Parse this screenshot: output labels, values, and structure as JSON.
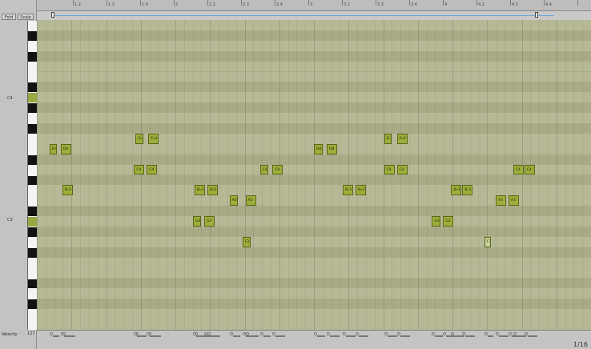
{
  "toolbar": {
    "fold_label": "Fold",
    "scale_label": "Scale"
  },
  "ruler": {
    "labels": [
      "1.2",
      "1.3",
      "1.4",
      "2",
      "2.2",
      "2.3",
      "2.4",
      "3",
      "3.2",
      "3.3",
      "3.4",
      "4",
      "4.2",
      "4.3",
      "4.4"
    ]
  },
  "keyboard": {
    "octave_labels": [
      "C4",
      "C3"
    ]
  },
  "roll": {
    "notes": [
      {
        "label": "E♭4",
        "row": 11,
        "start": 3.1,
        "dur": 0.18
      },
      {
        "label": "E♭4",
        "row": 11,
        "start": 3.5,
        "dur": 0.25
      },
      {
        "label": "D4",
        "row": 12,
        "start": 0.4,
        "dur": 0.18
      },
      {
        "label": "D4",
        "row": 12,
        "start": 0.75,
        "dur": 0.25
      },
      {
        "label": "C4",
        "row": 14,
        "start": 3.05,
        "dur": 0.25
      },
      {
        "label": "C4",
        "row": 14,
        "start": 3.45,
        "dur": 0.25
      },
      {
        "label": "C4",
        "row": 14,
        "start": 7.0,
        "dur": 0.2
      },
      {
        "label": "C4",
        "row": 14,
        "start": 7.4,
        "dur": 0.25
      },
      {
        "label": "B♭3",
        "row": 16,
        "start": 0.8,
        "dur": 0.25
      },
      {
        "label": "B♭3",
        "row": 16,
        "start": 4.95,
        "dur": 0.25
      },
      {
        "label": "B♭3",
        "row": 16,
        "start": 5.35,
        "dur": 0.25
      },
      {
        "label": "B♭3",
        "row": 16,
        "start": 9.6,
        "dur": 0.25
      },
      {
        "label": "B♭3",
        "row": 16,
        "start": 10.0,
        "dur": 0.25
      },
      {
        "label": "B♭3",
        "row": 16,
        "start": 13.0,
        "dur": 0.25
      },
      {
        "label": "B♭3",
        "row": 16,
        "start": 13.35,
        "dur": 0.25
      },
      {
        "label": "A3",
        "row": 17,
        "start": 6.05,
        "dur": 0.2
      },
      {
        "label": "A3",
        "row": 17,
        "start": 6.55,
        "dur": 0.25
      },
      {
        "label": "A3",
        "row": 17,
        "start": 14.4,
        "dur": 0.25
      },
      {
        "label": "A3",
        "row": 17,
        "start": 14.8,
        "dur": 0.25
      },
      {
        "label": "G3",
        "row": 19,
        "start": 4.9,
        "dur": 0.2
      },
      {
        "label": "G3",
        "row": 19,
        "start": 5.25,
        "dur": 0.25
      },
      {
        "label": "G3",
        "row": 19,
        "start": 12.4,
        "dur": 0.2
      },
      {
        "label": "G3",
        "row": 19,
        "start": 12.75,
        "dur": 0.25
      },
      {
        "label": "F3",
        "row": 21,
        "start": 6.45,
        "dur": 0.2
      },
      {
        "label": "F3",
        "row": 21,
        "start": 14.05,
        "dur": 0.15
      },
      {
        "label": "D4",
        "row": 12,
        "start": 8.7,
        "dur": 0.2
      },
      {
        "label": "D4",
        "row": 12,
        "start": 9.1,
        "dur": 0.25
      },
      {
        "label": "E♭4",
        "row": 11,
        "start": 10.9,
        "dur": 0.18
      },
      {
        "label": "E♭4",
        "row": 11,
        "start": 11.3,
        "dur": 0.25
      },
      {
        "label": "C4",
        "row": 14,
        "start": 10.9,
        "dur": 0.25
      },
      {
        "label": "C4",
        "row": 14,
        "start": 11.3,
        "dur": 0.25
      },
      {
        "label": "C4",
        "row": 14,
        "start": 14.95,
        "dur": 0.25
      },
      {
        "label": "C4",
        "row": 14,
        "start": 15.3,
        "dur": 0.25
      }
    ]
  },
  "velocity": {
    "label": "Velocity",
    "value": "127"
  },
  "grid": {
    "size": "1/16"
  },
  "colors": {
    "note_fill": "#9eae3a",
    "note_border": "#5a661a",
    "lane_light": "#b7b996",
    "lane_dark": "#a8ab85"
  }
}
